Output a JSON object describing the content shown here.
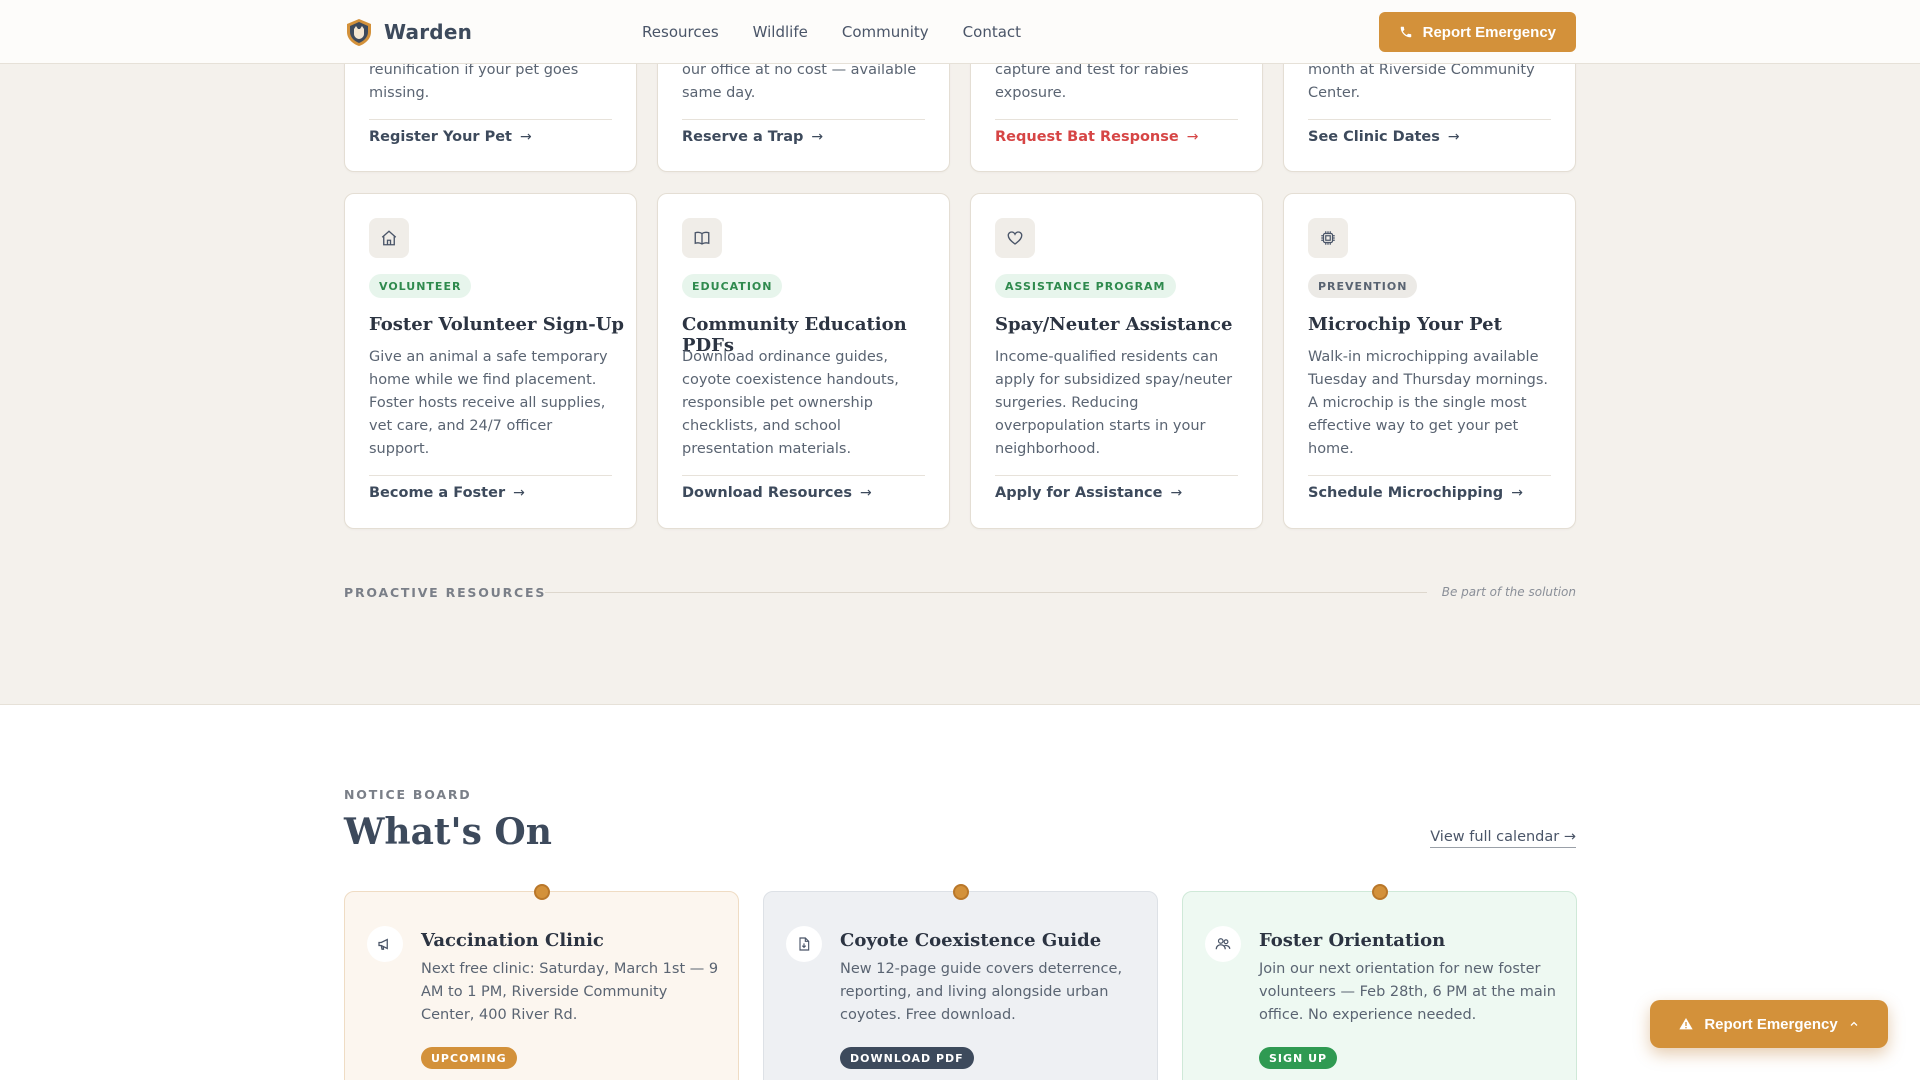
{
  "header": {
    "brand": "Warden",
    "nav": [
      "Resources",
      "Wildlife",
      "Community",
      "Contact"
    ],
    "cta": "Report Emergency"
  },
  "top_cards": [
    {
      "desc": "reunification if your pet goes missing.",
      "link": "Register Your Pet"
    },
    {
      "desc": "our office at no cost — available same day.",
      "link": "Reserve a Trap"
    },
    {
      "desc": "capture and test for rabies exposure.",
      "link": "Request Bat Response"
    },
    {
      "desc": "month at Riverside Community Center.",
      "link": "See Clinic Dates"
    }
  ],
  "cards": [
    {
      "tag": "VOLUNTEER",
      "title": "Foster Volunteer Sign-Up",
      "desc": "Give an animal a safe temporary home while we find placement. Foster hosts receive all supplies, vet care, and 24/7 officer support.",
      "link": "Become a Foster",
      "icon": "home-icon"
    },
    {
      "tag": "EDUCATION",
      "title": "Community Education PDFs",
      "desc": "Download ordinance guides, coyote coexistence handouts, responsible pet ownership checklists, and school presentation materials.",
      "link": "Download Resources",
      "icon": "book-icon"
    },
    {
      "tag": "ASSISTANCE PROGRAM",
      "title": "Spay/Neuter Assistance",
      "desc": "Income-qualified residents can apply for subsidized spay/neuter surgeries. Reducing overpopulation starts in your neighborhood.",
      "link": "Apply for Assistance",
      "icon": "heart-icon"
    },
    {
      "tag": "PREVENTION",
      "title": "Microchip Your Pet",
      "desc": "Walk-in microchipping available Tuesday and Thursday mornings. A microchip is the single most effective way to get your pet home.",
      "link": "Schedule Microchipping",
      "icon": "chip-icon"
    }
  ],
  "section": {
    "label": "PROACTIVE RESOURCES",
    "note": "Be part of the solution"
  },
  "notice": {
    "eyebrow": "NOTICE BOARD",
    "title": "What's On",
    "view_all": "View full calendar →",
    "items": [
      {
        "title": "Vaccination Clinic",
        "desc": "Next free clinic: Saturday, March 1st — 9 AM to 1 PM, Riverside Community Center, 400 River Rd.",
        "badge": "UPCOMING",
        "icon": "megaphone-icon"
      },
      {
        "title": "Coyote Coexistence Guide",
        "desc": "New 12-page guide covers deterrence, reporting, and living alongside urban coyotes. Free download.",
        "badge": "DOWNLOAD PDF",
        "icon": "document-icon"
      },
      {
        "title": "Foster Orientation",
        "desc": "Join our next orientation for new foster volunteers — Feb 28th, 6 PM at the main office. No experience needed.",
        "badge": "SIGN UP",
        "icon": "people-icon"
      }
    ]
  },
  "floating": {
    "label": "Report Emergency"
  },
  "colors": {
    "accent": "#d3913a",
    "danger": "#d64545",
    "green": "#2f8a4e",
    "slate": "#3d4a5c"
  }
}
